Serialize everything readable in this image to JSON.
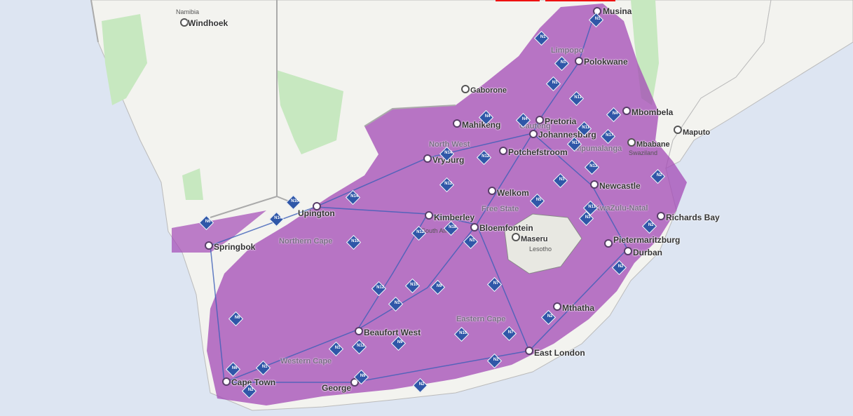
{
  "map": {
    "cities": [
      {
        "id": "windhoek",
        "name": "Windhoek"
      },
      {
        "id": "musina",
        "name": "Musina"
      },
      {
        "id": "polokwane",
        "name": "Polokwane"
      },
      {
        "id": "gaborone",
        "name": "Gaborone"
      },
      {
        "id": "mahikeng",
        "name": "Mahikeng"
      },
      {
        "id": "pretoria",
        "name": "Pretoria"
      },
      {
        "id": "johannesburg",
        "name": "Johannesburg"
      },
      {
        "id": "mbombela",
        "name": "Mbombela"
      },
      {
        "id": "maputo",
        "name": "Maputo"
      },
      {
        "id": "mbabane",
        "name": "Mbabane"
      },
      {
        "id": "potchefstroom",
        "name": "Potchefstroom"
      },
      {
        "id": "vryburg",
        "name": "Vryburg"
      },
      {
        "id": "newcastle",
        "name": "Newcastle"
      },
      {
        "id": "welkom",
        "name": "Welkom"
      },
      {
        "id": "upington",
        "name": "Upington"
      },
      {
        "id": "kimberley",
        "name": "Kimberley"
      },
      {
        "id": "richards-bay",
        "name": "Richards Bay"
      },
      {
        "id": "bloemfontein",
        "name": "Bloemfontein"
      },
      {
        "id": "springbok",
        "name": "Springbok"
      },
      {
        "id": "maseru",
        "name": "Maseru"
      },
      {
        "id": "pietermaritzburg",
        "name": "Pietermaritzburg"
      },
      {
        "id": "durban",
        "name": "Durban"
      },
      {
        "id": "mthatha",
        "name": "Mthatha"
      },
      {
        "id": "beaufort-west",
        "name": "Beaufort West"
      },
      {
        "id": "east-london",
        "name": "East London"
      },
      {
        "id": "cape-town",
        "name": "Cape Town"
      },
      {
        "id": "george",
        "name": "George"
      }
    ],
    "regions": [
      {
        "id": "limpopo",
        "name": "Limpopo"
      },
      {
        "id": "gauteng",
        "name": "Gauteng"
      },
      {
        "id": "north-west",
        "name": "North West"
      },
      {
        "id": "mpumalanga",
        "name": "Mpumalanga"
      },
      {
        "id": "free-state",
        "name": "Free State"
      },
      {
        "id": "kwazulu-natal",
        "name": "KwaZulu-Natal"
      },
      {
        "id": "northern-cape",
        "name": "Northern Cape"
      },
      {
        "id": "eastern-cape",
        "name": "Eastern Cape"
      },
      {
        "id": "western-cape",
        "name": "Western Cape"
      }
    ],
    "small_labels": [
      {
        "id": "namibia",
        "name": "Namibia"
      },
      {
        "id": "swaziland",
        "name": "Swaziland"
      },
      {
        "id": "lesotho",
        "name": "Lesotho"
      },
      {
        "id": "south-africa",
        "name": "South Africa"
      }
    ],
    "routes": [
      "N1",
      "N2",
      "N3",
      "N4",
      "N5",
      "N6",
      "N7",
      "N9",
      "N10",
      "N11",
      "N12",
      "N14",
      "N17",
      "N18"
    ],
    "colors": {
      "ocean": "#dde5f2",
      "land": "#f3f3ef",
      "coverage": "#a349b6",
      "park": "#c7e8c0",
      "road": "#3c5fb8",
      "border": "#aaaaaa"
    }
  }
}
